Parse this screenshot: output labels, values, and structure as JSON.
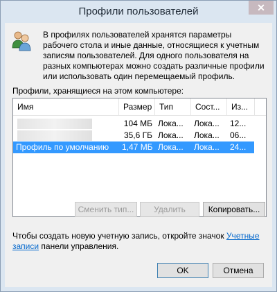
{
  "window": {
    "title": "Профили пользователей",
    "close_label": "✕"
  },
  "description": "В профилях пользователей хранятся параметры рабочего стола и иные данные, относящиеся к учетным записям пользователей. Для одного пользователя на разных компьютерах можно создать различные профили или использовать один перемещаемый профиль.",
  "profiles": {
    "caption": "Профили, хранящиеся на этом компьютере:",
    "columns": [
      "Имя",
      "Размер",
      "Тип",
      "Сост...",
      "Из..."
    ],
    "rows": [
      {
        "name": "",
        "size": "104 МБ",
        "type": "Лока...",
        "status": "Лока...",
        "modified": "12..."
      },
      {
        "name": "",
        "size": "35,6 ГБ",
        "type": "Лока...",
        "status": "Лока...",
        "modified": "06..."
      },
      {
        "name": "Профиль по умолчанию",
        "size": "1,47 МБ",
        "type": "Лока...",
        "status": "Лока...",
        "modified": "24..."
      }
    ],
    "selected_row": 2
  },
  "buttons": {
    "change_type": "Сменить тип...",
    "delete": "Удалить",
    "copy": "Копировать...",
    "ok": "OK",
    "cancel": "Отмена"
  },
  "footer": {
    "text_before": "Чтобы создать новую учетную запись, откройте значок ",
    "link": "Учетные записи",
    "text_after": " панели управления."
  },
  "colors": {
    "selection": "#3399ff",
    "link": "#0066cc",
    "close_button": "#c7b9bf"
  }
}
